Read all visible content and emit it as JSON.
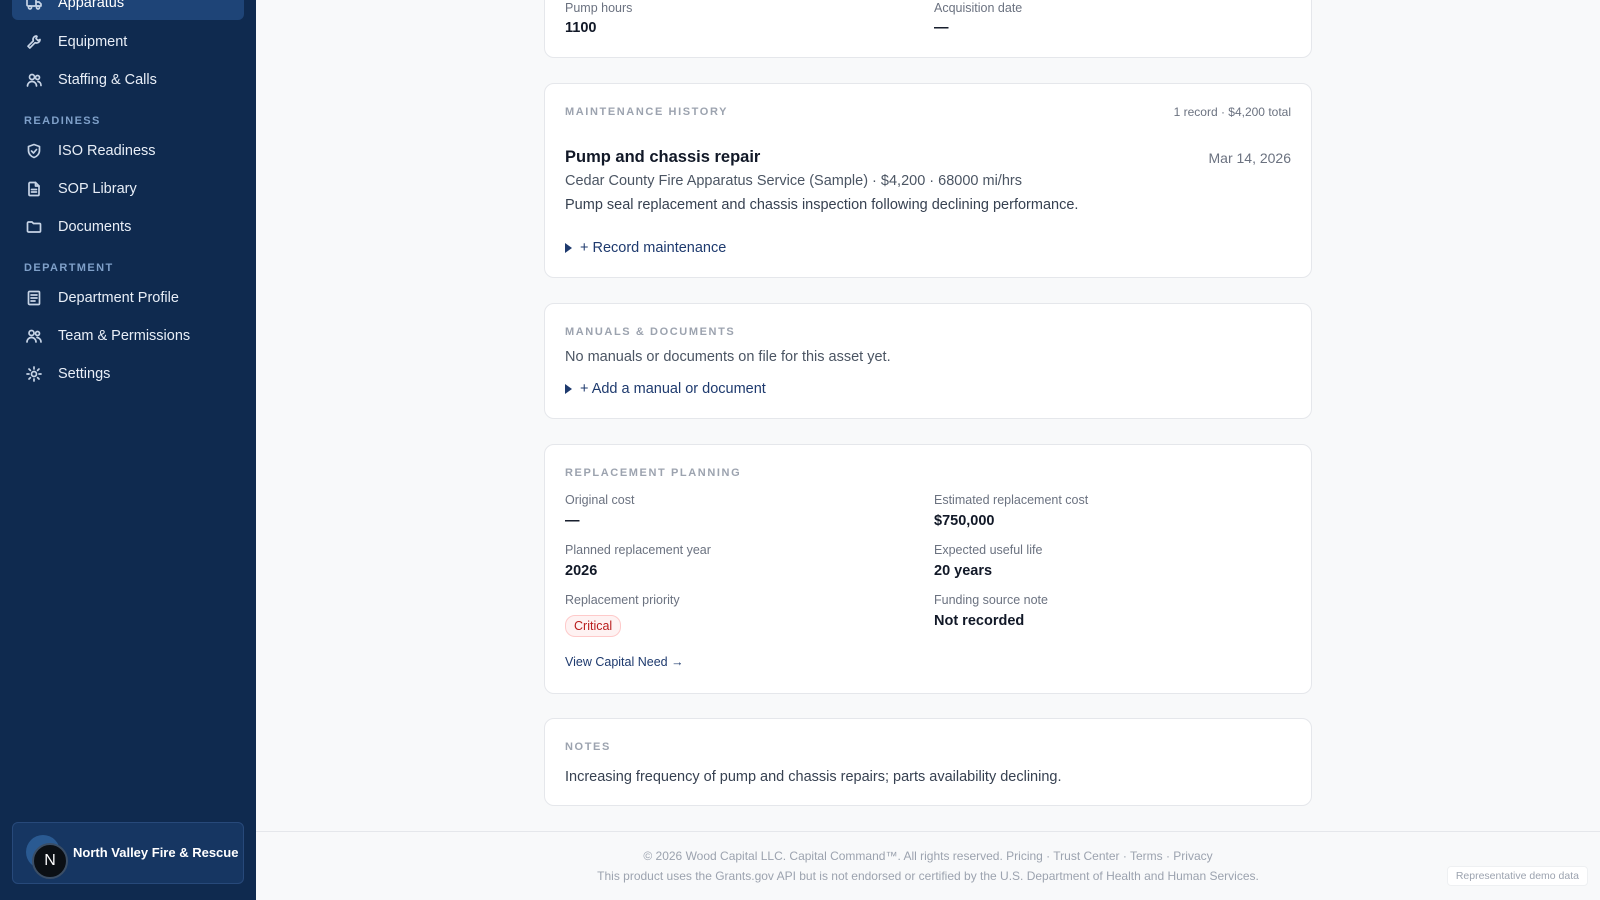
{
  "sidebar": {
    "nav_top": [
      {
        "label": "Apparatus",
        "icon": "truck-icon",
        "active": true
      },
      {
        "label": "Equipment",
        "icon": "wrench-icon"
      },
      {
        "label": "Staffing & Calls",
        "icon": "users-icon"
      }
    ],
    "readiness_label": "READINESS",
    "nav_readiness": [
      {
        "label": "ISO Readiness",
        "icon": "shield-check-icon"
      },
      {
        "label": "SOP Library",
        "icon": "file-text-icon"
      },
      {
        "label": "Documents",
        "icon": "folder-icon"
      }
    ],
    "department_label": "DEPARTMENT",
    "nav_department": [
      {
        "label": "Department Profile",
        "icon": "document-icon"
      },
      {
        "label": "Team & Permissions",
        "icon": "team-icon"
      },
      {
        "label": "Settings",
        "icon": "gear-icon"
      }
    ],
    "dept_card": {
      "initial": "N",
      "name": "North Valley Fire & Rescue"
    }
  },
  "details": {
    "pump_hours_label": "Pump hours",
    "pump_hours": "1100",
    "acquisition_date_label": "Acquisition date",
    "acquisition_date": "—"
  },
  "maintenance": {
    "eyebrow": "MAINTENANCE HISTORY",
    "summary": "1 record · $4,200 total",
    "record": {
      "title": "Pump and chassis repair",
      "date": "Mar 14, 2026",
      "meta": "Cedar County Fire Apparatus Service (Sample) · $4,200 · 68000 mi/hrs",
      "description": "Pump seal replacement and chassis inspection following declining performance."
    },
    "add_label": "+ Record maintenance"
  },
  "manuals": {
    "eyebrow": "MANUALS & DOCUMENTS",
    "empty_text": "No manuals or documents on file for this asset yet.",
    "add_label": "+ Add a manual or document"
  },
  "replacement": {
    "eyebrow": "REPLACEMENT PLANNING",
    "original_cost_label": "Original cost",
    "original_cost": "—",
    "est_cost_label": "Estimated replacement cost",
    "est_cost": "$750,000",
    "planned_year_label": "Planned replacement year",
    "planned_year": "2026",
    "useful_life_label": "Expected useful life",
    "useful_life": "20 years",
    "priority_label": "Replacement priority",
    "priority": "Critical",
    "funding_label": "Funding source note",
    "funding": "Not recorded",
    "link_label": "View Capital Need →"
  },
  "notes": {
    "eyebrow": "NOTES",
    "text": "Increasing frequency of pump and chassis repairs; parts availability declining."
  },
  "footer": {
    "line1": "© 2026 Wood Capital LLC. Capital Command™. All rights reserved. Pricing · Trust Center · Terms · Privacy",
    "line2": "This product uses the Grants.gov API but is not endorsed or certified by the U.S. Department of Health and Human Services.",
    "demo_tag": "Representative demo data"
  }
}
